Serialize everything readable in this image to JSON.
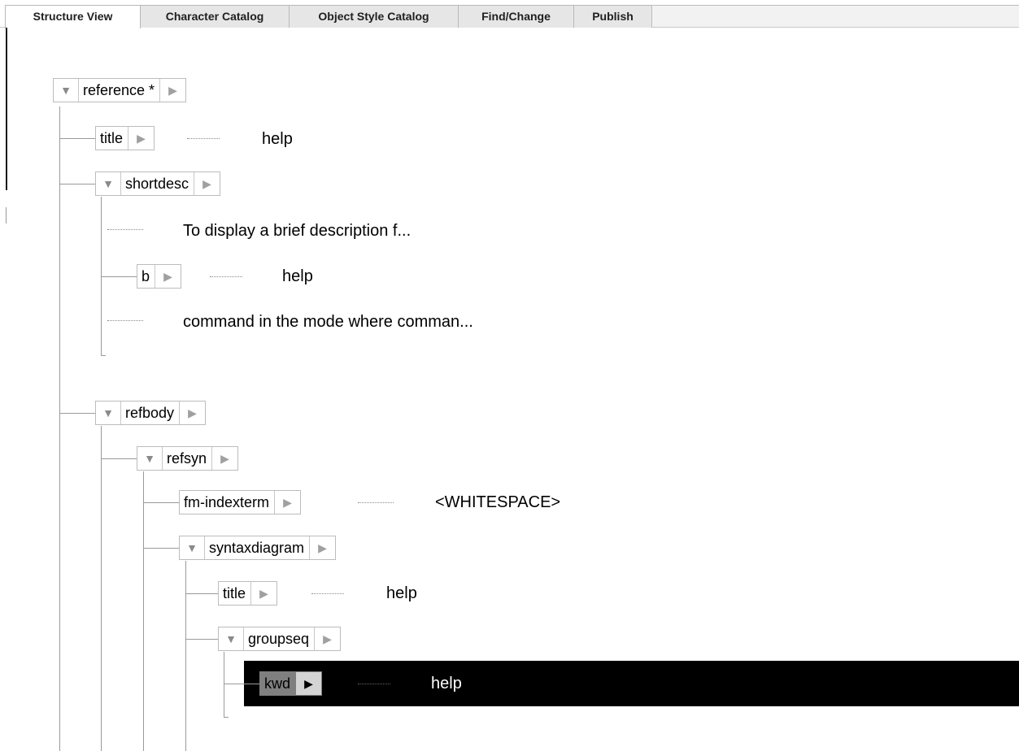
{
  "tabs": [
    {
      "label": "Structure View",
      "active": true
    },
    {
      "label": "Character Catalog",
      "active": false
    },
    {
      "label": "Object Style Catalog",
      "active": false
    },
    {
      "label": "Find/Change",
      "active": false
    },
    {
      "label": "Publish",
      "active": false
    }
  ],
  "icons": {
    "collapse": "▼",
    "expand": "▶"
  },
  "tree": {
    "reference": {
      "label": "reference *"
    },
    "title": {
      "label": "title",
      "content": "help"
    },
    "shortdesc": {
      "label": "shortdesc"
    },
    "shortdesc_text1": "To display a brief description f...",
    "b": {
      "label": "b",
      "content": "help"
    },
    "shortdesc_text2": "command in the mode where comman...",
    "refbody": {
      "label": "refbody"
    },
    "refsyn": {
      "label": "refsyn"
    },
    "fm_indexterm": {
      "label": "fm-indexterm",
      "content": "<WHITESPACE>"
    },
    "syntaxdiagram": {
      "label": "syntaxdiagram"
    },
    "sd_title": {
      "label": "title",
      "content": "help"
    },
    "groupseq": {
      "label": "groupseq"
    },
    "kwd": {
      "label": "kwd",
      "content": "help",
      "selected": true
    }
  }
}
